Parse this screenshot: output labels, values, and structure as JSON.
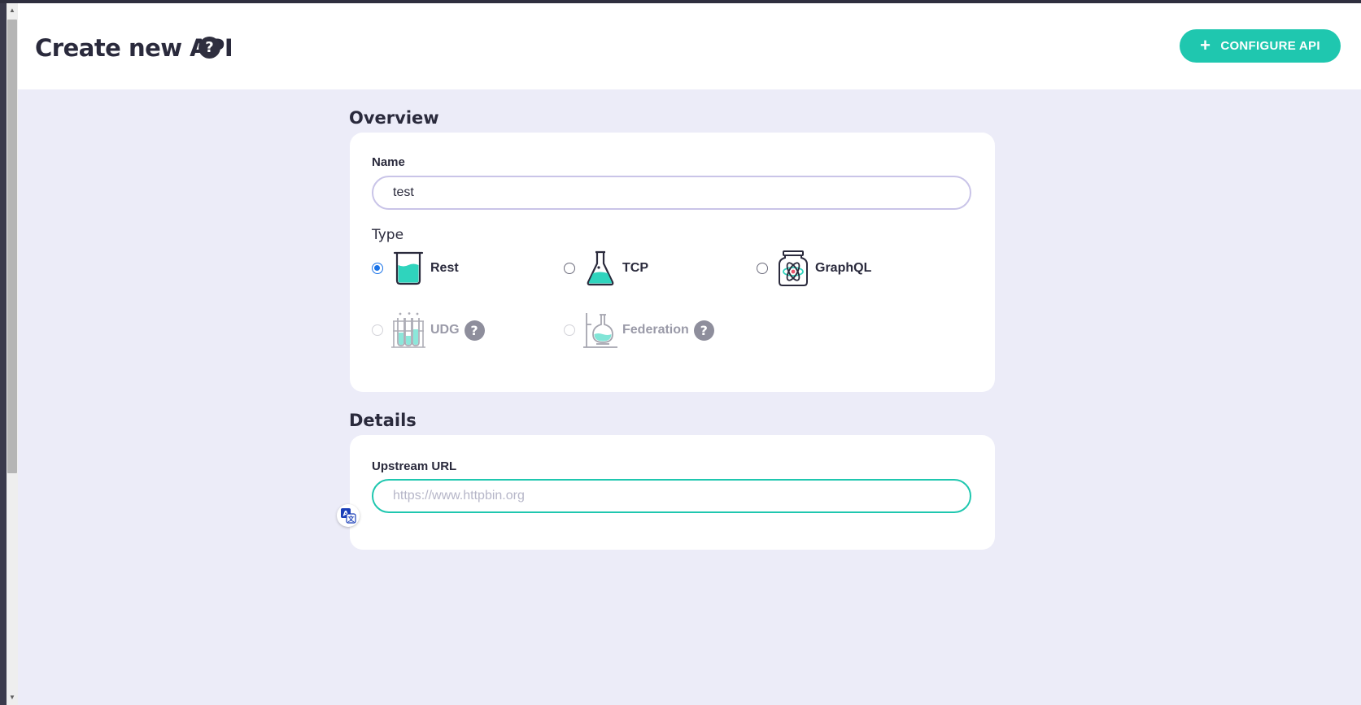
{
  "header": {
    "title": "Create new API",
    "help_glyph": "?",
    "configure_button": {
      "icon": "+",
      "label": "CONFIGURE API"
    }
  },
  "overview": {
    "section_title": "Overview",
    "name_label": "Name",
    "name_value": "test",
    "type_label": "Type",
    "types": [
      {
        "label": "Rest",
        "icon": "beaker-icon",
        "selected": true,
        "disabled": false
      },
      {
        "label": "TCP",
        "icon": "flask-icon",
        "selected": false,
        "disabled": false
      },
      {
        "label": "GraphQL",
        "icon": "atom-jar-icon",
        "selected": false,
        "disabled": false
      },
      {
        "label": "UDG",
        "icon": "test-tubes-icon",
        "selected": false,
        "disabled": true,
        "has_help": true
      },
      {
        "label": "Federation",
        "icon": "distillation-flask-icon",
        "selected": false,
        "disabled": true,
        "has_help": true
      }
    ]
  },
  "details": {
    "section_title": "Details",
    "upstream_label": "Upstream URL",
    "upstream_value": "",
    "upstream_placeholder": "https://www.httpbin.org"
  },
  "colors": {
    "accent": "#1fc7af",
    "text": "#2a2a3c",
    "background": "#ececf8",
    "radio_selected": "#1a73e8"
  }
}
